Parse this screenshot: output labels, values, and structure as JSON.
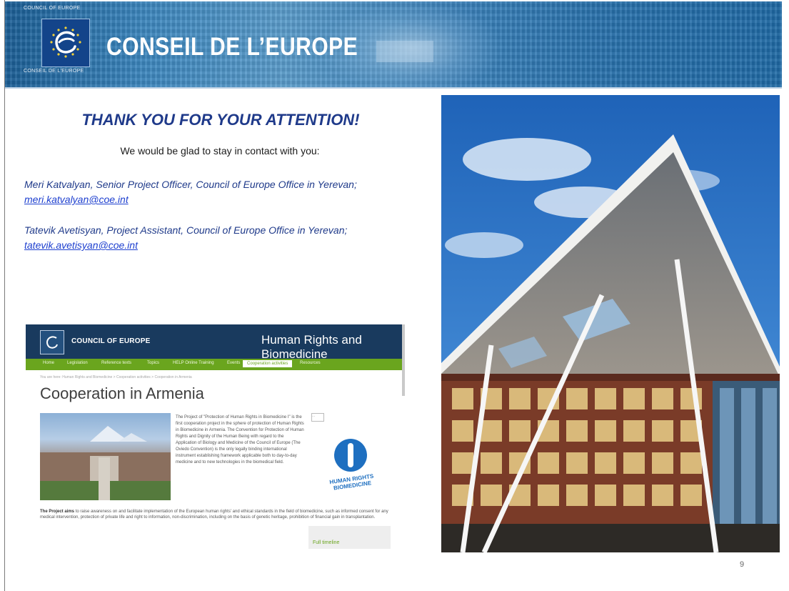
{
  "banner": {
    "small_top": "COUNCIL OF EUROPE",
    "small_bottom": "CONSEIL DE L'EUROPE",
    "title": "CONSEIL DE L’EUROPE"
  },
  "headline": "THANK YOU FOR YOUR ATTENTION!",
  "subtitle": "We would be glad to stay in contact with you:",
  "contacts": [
    {
      "line": "Meri Katvalyan, Senior Project Officer, Council of Europe Office in Yerevan;",
      "email": "meri.katvalyan@coe.int"
    },
    {
      "line": "Tatevik Avetisyan, Project Assistant, Council of Europe Office in Yerevan;",
      "email": "tatevik.avetisyan@coe.int"
    }
  ],
  "website": {
    "brand": "COUNCIL OF EUROPE",
    "site_title": "Human Rights and Biomedicine",
    "nav": [
      "Home",
      "Legislation",
      "Reference texts",
      "Topics",
      "HELP Online Training",
      "Events",
      "Cooperation activities",
      "Resources"
    ],
    "breadcrumb": "You are here: Human Rights and Biomedicine > Cooperation activities > Cooperation in Armenia",
    "heading": "Cooperation in Armenia",
    "col_text": "The Project of \"Protection of Human Rights in Biomedicine I\" is the first cooperation project in the sphere of protection of Human Rights in Biomedicine in Armenia. The Convention for Protection of Human Rights and Dignity of the Human Being with regard to the Application of Biology and Medicine of the Council of Europe (The Oviedo Convention) is the only legally binding international instrument establishing framework applicable both to day-to-day medicine and to new technologies in the biomedical field.",
    "body_bold": "The Project aims",
    "body_text": " to raise awareness on and facilitate implementation of the European human rights' and ethical standards in the field of biomedicine, such as informed consent for any medical intervention, protection of private life and right to information, non-discrimination, including on the basis of genetic heritage, prohibition of financial gain in transplantation.",
    "logo_text": "HUMAN RIGHTS BIOMEDICINE",
    "box_label": "...",
    "foot_link": "Full timeline"
  },
  "page_number": "9",
  "colors": {
    "headline": "#1f3a8a",
    "link": "#1d3fcf",
    "banner": "#2a73ae",
    "nav_green": "#6aa51e",
    "web_header": "#193a5e"
  }
}
